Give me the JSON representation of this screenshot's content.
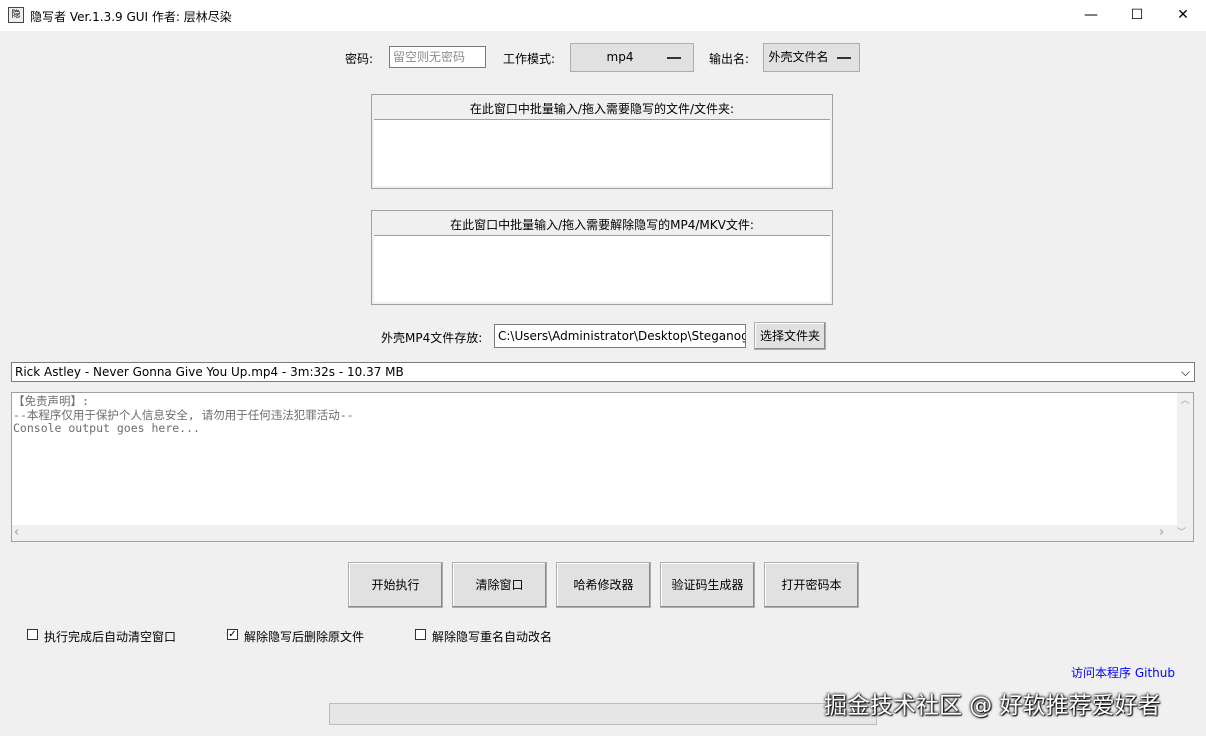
{
  "window": {
    "title": "隐写者 Ver.1.3.9 GUI 作者: 层林尽染",
    "icon_glyph": "隐",
    "minimize": "—",
    "maximize": "☐",
    "close": "✕"
  },
  "top_row": {
    "password_label": "密码:",
    "password_placeholder": "留空则无密码",
    "mode_label": "工作模式:",
    "mode_value": "mp4",
    "output_label": "输出名:",
    "output_value": "外壳文件名"
  },
  "groups": {
    "hide_title": "在此窗口中批量输入/拖入需要隐写的文件/文件夹:",
    "reveal_title": "在此窗口中批量输入/拖入需要解除隐写的MP4/MKV文件:"
  },
  "shell_dir": {
    "label": "外壳MP4文件存放:",
    "value": "C:\\Users\\Administrator\\Desktop\\Steganog",
    "browse_button": "选择文件夹"
  },
  "shell_file": {
    "selected": "Rick Astley - Never Gonna Give You Up.mp4 - 3m:32s - 10.37 MB",
    "arrow": "⌵"
  },
  "console": {
    "lines": [
      "【免责声明】:",
      "--本程序仅用于保护个人信息安全, 请勿用于任何违法犯罪活动--",
      "Console output goes here..."
    ],
    "scroll_up": "︿",
    "scroll_down": "﹀",
    "scroll_left": "‹",
    "scroll_right": "›"
  },
  "actions": {
    "start": "开始执行",
    "clear": "清除窗口",
    "hash": "哈希修改器",
    "captcha": "验证码生成器",
    "codebook": "打开密码本"
  },
  "options": [
    {
      "label": "执行完成后自动清空窗口",
      "checked": false,
      "mark": ""
    },
    {
      "label": "解除隐写后删除原文件",
      "checked": true,
      "mark": "✓"
    },
    {
      "label": "解除隐写重名自动改名",
      "checked": false,
      "mark": ""
    }
  ],
  "github_link": "访问本程序 Github",
  "progress": 0,
  "watermark": "掘金技术社区 @ 好软推荐爱好者",
  "colors": {
    "link": "#0000ff",
    "background": "#f0f0f0"
  }
}
